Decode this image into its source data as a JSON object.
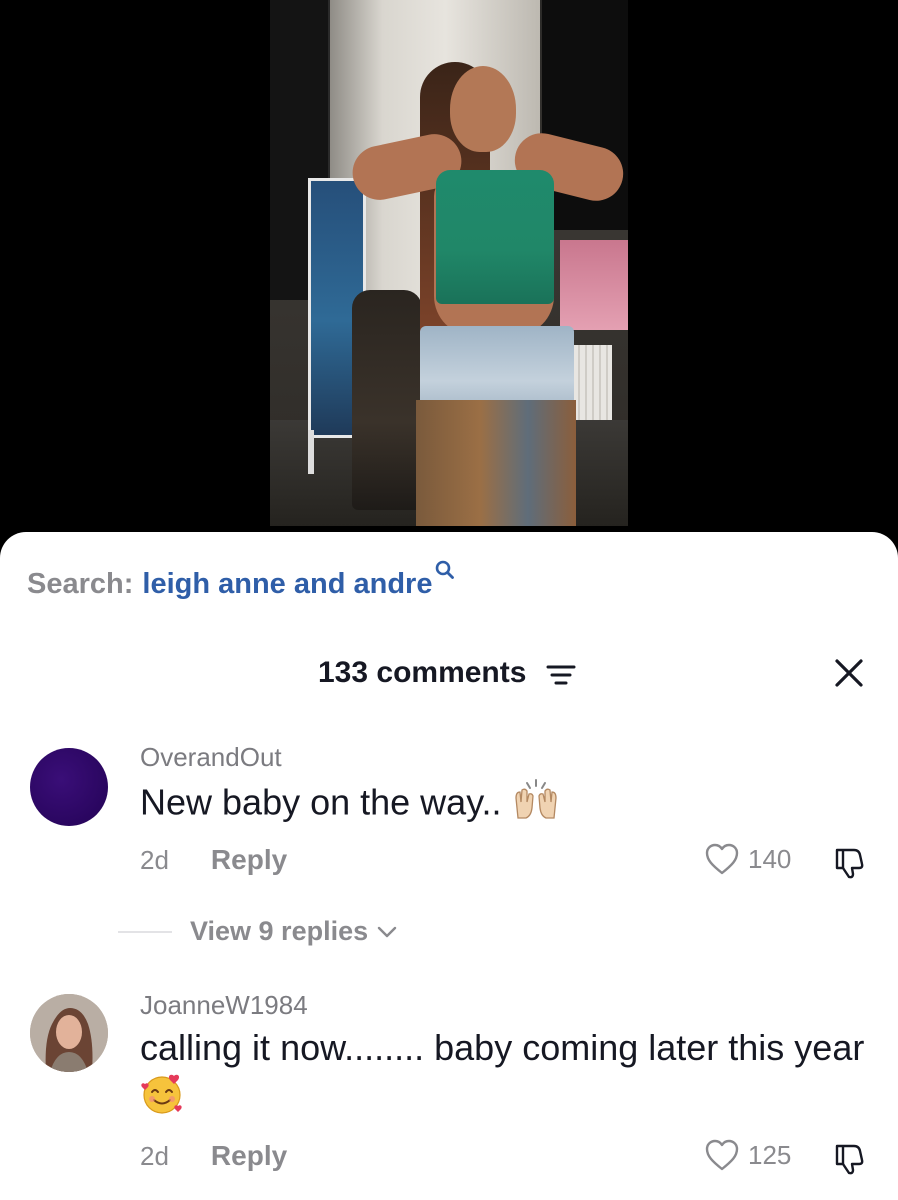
{
  "search": {
    "label": "Search:",
    "query": "leigh anne and andre"
  },
  "header": {
    "comments_count": "133 comments"
  },
  "comments": [
    {
      "username": "OverandOut",
      "text": "New baby on the way..",
      "emoji": "raising-hands",
      "date": "2d",
      "reply_label": "Reply",
      "likes": "140",
      "avatar": "purple-avatar"
    },
    {
      "username": "JoanneW1984",
      "text": "calling it now........ baby coming later this year",
      "emoji": "smiling-face-with-hearts",
      "date": "2d",
      "reply_label": "Reply",
      "likes": "125",
      "avatar": "photo-avatar"
    }
  ],
  "replies": {
    "label": "View 9 replies"
  },
  "colors": {
    "search_query": "#2f5ea8",
    "muted_text": "#8a8a8e",
    "primary_text": "#161823"
  }
}
